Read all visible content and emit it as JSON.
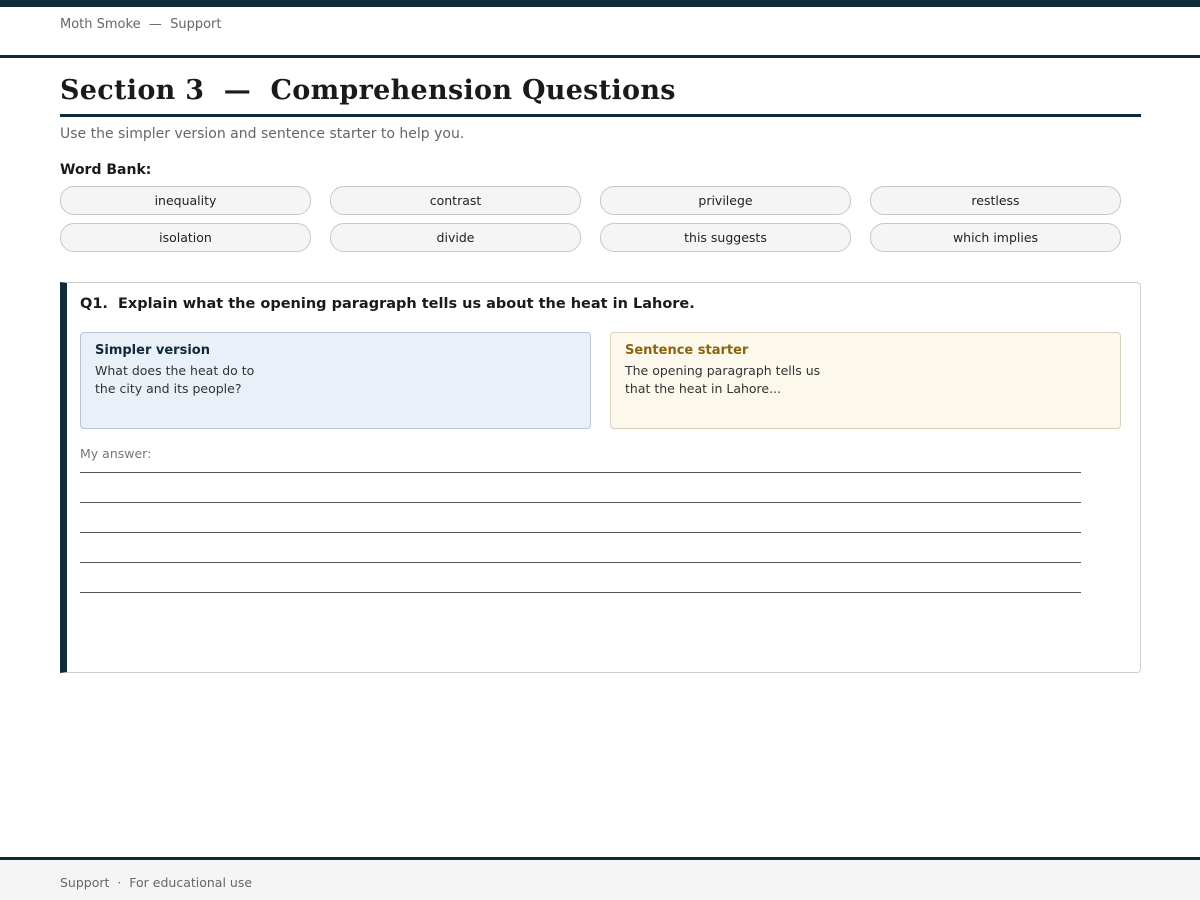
{
  "header": {
    "breadcrumb": "Moth Smoke  —  Support"
  },
  "page": {
    "title": "Section 3  —  Comprehension Questions",
    "subtitle": "Use the simpler version and sentence starter to help you."
  },
  "word_bank": {
    "label": "Word Bank:",
    "words": [
      "inequality",
      "contrast",
      "privilege",
      "restless",
      "isolation",
      "divide",
      "this suggests",
      "which implies"
    ]
  },
  "question": {
    "title": "Q1.  Explain what the opening paragraph tells us about the heat in Lahore.",
    "simpler": {
      "heading": "Simpler version",
      "line1": "What does the heat do to",
      "line2": "the city and its people?"
    },
    "starter": {
      "heading": "Sentence starter",
      "line1": "The opening paragraph tells us",
      "line2": "that the heat in Lahore..."
    },
    "answer_label": "My answer:"
  },
  "footer": {
    "text": "Support  ·  For educational use"
  },
  "colors": {
    "accent": "#0f2a3a",
    "simple_bg": "#e9f0f8",
    "starter_bg": "#fcf8ec",
    "starter_heading": "#8a6410"
  }
}
